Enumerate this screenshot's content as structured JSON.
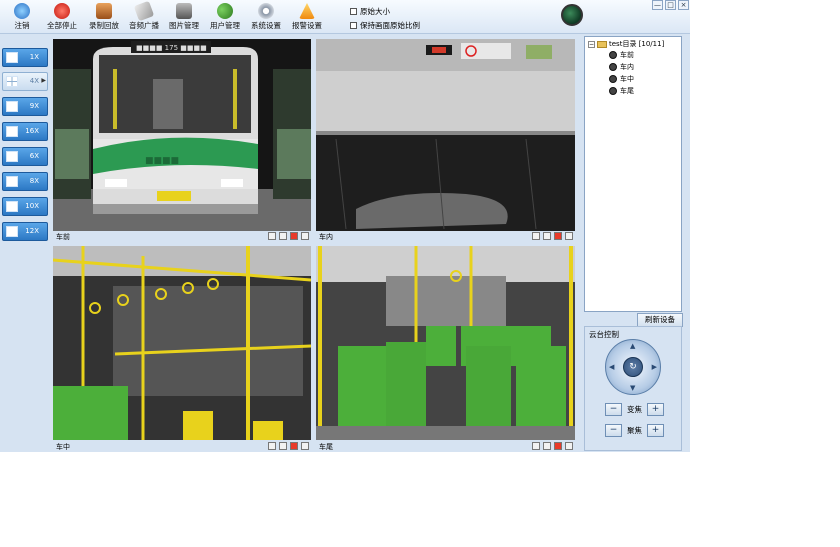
{
  "toolbar": {
    "items": [
      {
        "label": "注销",
        "icon": "logout-globe-icon",
        "color": "#3a7ad0"
      },
      {
        "label": "全部停止",
        "icon": "stop-all-icon",
        "color": "#d9261c"
      },
      {
        "label": "录制回放",
        "icon": "record-playback-icon",
        "color": "#c9772b"
      },
      {
        "label": "音频广播",
        "icon": "audio-broadcast-icon",
        "color": "#9a9a9a"
      },
      {
        "label": "图片管理",
        "icon": "camera-icon",
        "color": "#555555"
      },
      {
        "label": "用户管理",
        "icon": "users-icon",
        "color": "#4a9a3a"
      },
      {
        "label": "系统设置",
        "icon": "gear-icon",
        "color": "#8a96a6"
      },
      {
        "label": "报警设置",
        "icon": "alarm-warning-icon",
        "color": "#f0a020"
      }
    ],
    "checkbox_original_size": "原始大小",
    "checkbox_keep_ratio": "保持画面原始比例"
  },
  "window_controls": [
    "—",
    "□",
    "×"
  ],
  "layouts": [
    {
      "label": "1X",
      "active": false
    },
    {
      "label": "4X",
      "active": true
    },
    {
      "label": "9X",
      "active": false
    },
    {
      "label": "16X",
      "active": false
    },
    {
      "label": "6X",
      "active": false
    },
    {
      "label": "8X",
      "active": false
    },
    {
      "label": "10X",
      "active": false
    },
    {
      "label": "12X",
      "active": false
    }
  ],
  "panes": [
    {
      "label": "车前"
    },
    {
      "label": "车内"
    },
    {
      "label": "车中"
    },
    {
      "label": "车尾"
    }
  ],
  "tree": {
    "root": "test目录 [10/11]",
    "items": [
      "车前",
      "车内",
      "车中",
      "车尾"
    ]
  },
  "refresh_button": "刷新设备",
  "ptz": {
    "title": "云台控制",
    "zoom": "变焦",
    "focus": "聚焦",
    "minus": "−",
    "plus": "+"
  },
  "colors": {
    "panel_bg": "#d6e3f2",
    "layout_button": "#3a88d4",
    "seat_green": "#4caf3a",
    "rail_yellow": "#e8d21c"
  }
}
